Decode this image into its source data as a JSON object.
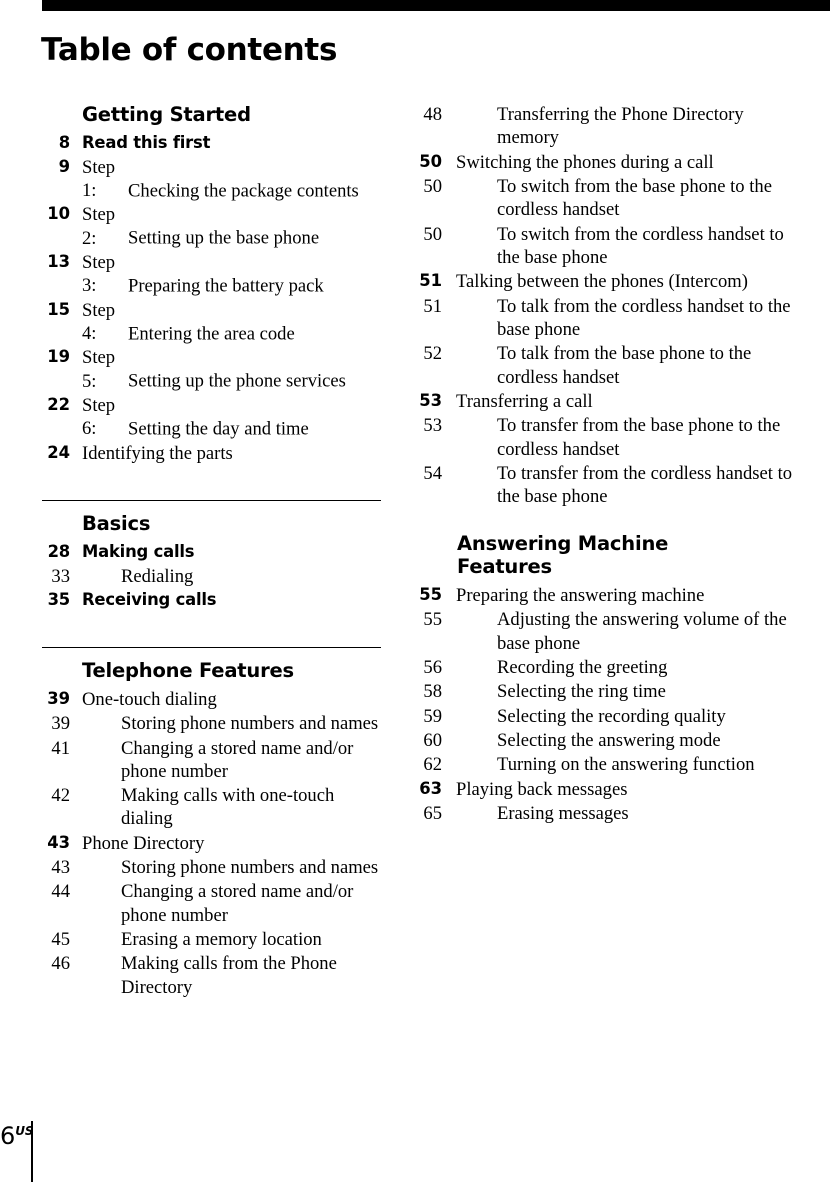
{
  "page_title": "Table of contents",
  "folio": {
    "number": "6",
    "suffix": "US"
  },
  "left_column": {
    "sections": [
      {
        "heading": "Getting Started",
        "entries": [
          {
            "page": "8",
            "text": "Read this first"
          },
          {
            "page": "9",
            "step": "Step 1:",
            "text": "Checking the package contents"
          },
          {
            "page": "10",
            "step": "Step 2:",
            "text": "Setting up the base phone"
          },
          {
            "page": "13",
            "step": "Step 3:",
            "text": "Preparing the battery pack"
          },
          {
            "page": "15",
            "step": "Step 4:",
            "text": "Entering the area code"
          },
          {
            "page": "19",
            "step": "Step 5:",
            "text": "Setting up the phone services"
          },
          {
            "page": "22",
            "step": "Step 6:",
            "text": "Setting the day and time"
          },
          {
            "page": "24",
            "text": "Identifying the parts"
          }
        ]
      },
      {
        "heading": "Basics",
        "entries": [
          {
            "page": "28",
            "text": "Making calls"
          },
          {
            "page": "33",
            "text": "Redialing"
          },
          {
            "page": "35",
            "text": "Receiving calls"
          }
        ]
      },
      {
        "heading": "Telephone Features",
        "entries": [
          {
            "page": "39",
            "text": "One-touch dialing"
          },
          {
            "page": "39",
            "text": "Storing phone numbers and names"
          },
          {
            "page": "41",
            "text": "Changing a stored name and/or phone number"
          },
          {
            "page": "42",
            "text": "Making calls with one-touch dialing"
          },
          {
            "page": "43",
            "text": "Phone Directory"
          },
          {
            "page": "43",
            "text": "Storing phone numbers and names"
          },
          {
            "page": "44",
            "text": "Changing a stored name and/or phone number"
          },
          {
            "page": "45",
            "text": "Erasing a memory location"
          },
          {
            "page": "46",
            "text": "Making calls from the Phone Directory"
          }
        ]
      }
    ]
  },
  "right_column": {
    "sections": [
      {
        "heading": "",
        "entries": [
          {
            "page": "48",
            "text": "Transferring the Phone Directory memory"
          },
          {
            "page": "50",
            "text": "Switching the phones during a call"
          },
          {
            "page": "50",
            "text": "To switch from the base phone to the cordless handset"
          },
          {
            "page": "50",
            "text": "To switch from the cordless handset to the base phone"
          },
          {
            "page": "51",
            "text": "Talking between the phones (Intercom)"
          },
          {
            "page": "51",
            "text": "To talk from the cordless handset to the base phone"
          },
          {
            "page": "52",
            "text": "To talk from the base phone to the cordless handset"
          },
          {
            "page": "53",
            "text": "Transferring a call"
          },
          {
            "page": "53",
            "text": "To transfer from the base phone to the cordless handset"
          },
          {
            "page": "54",
            "text": "To transfer from the cordless handset to the base phone"
          }
        ]
      },
      {
        "heading_line1": "Answering Machine",
        "heading_line2": "Features",
        "entries": [
          {
            "page": "55",
            "text": "Preparing the answering machine"
          },
          {
            "page": "55",
            "text": "Adjusting the answering volume of the base phone"
          },
          {
            "page": "56",
            "text": "Recording the greeting"
          },
          {
            "page": "58",
            "text": "Selecting the ring time"
          },
          {
            "page": "59",
            "text": "Selecting the recording quality"
          },
          {
            "page": "60",
            "text": "Selecting the answering mode"
          },
          {
            "page": "62",
            "text": "Turning on the answering function"
          },
          {
            "page": "63",
            "text": "Playing back messages"
          },
          {
            "page": "65",
            "text": "Erasing messages"
          }
        ]
      }
    ]
  }
}
